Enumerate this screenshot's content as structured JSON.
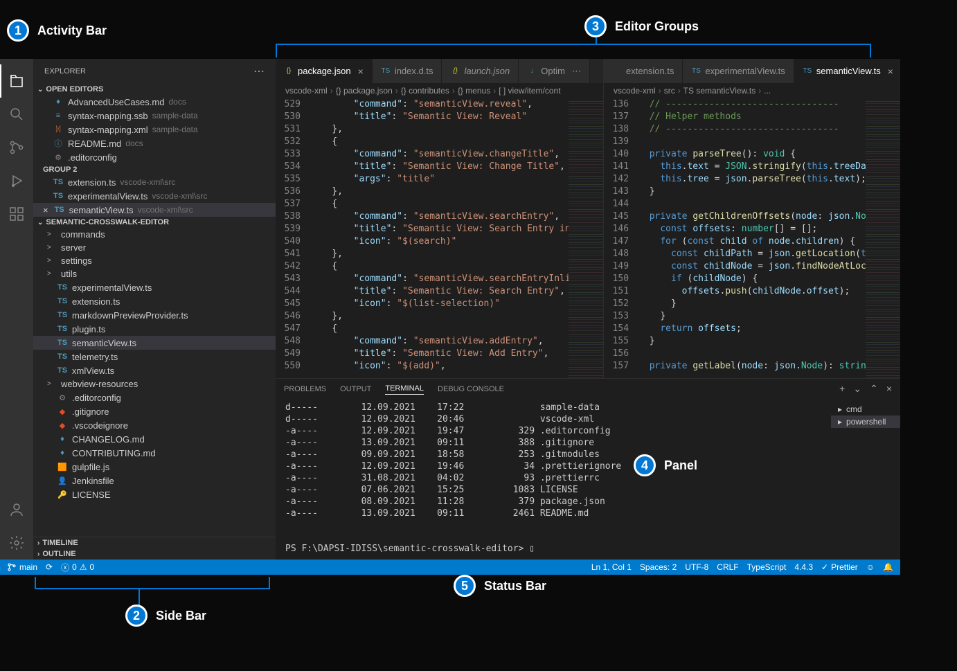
{
  "annotations": {
    "a1": "Activity Bar",
    "a2": "Side Bar",
    "a3": "Editor Groups",
    "a4": "Panel",
    "a5": "Status Bar"
  },
  "sidebar": {
    "title": "EXPLORER",
    "open_editors": "OPEN EDITORS",
    "group2": "GROUP 2",
    "project": "SEMANTIC-CROSSWALK-EDITOR",
    "timeline": "TIMELINE",
    "outline": "OUTLINE",
    "editors": [
      {
        "name": "AdvancedUseCases.md",
        "detail": "docs",
        "icon": "md"
      },
      {
        "name": "syntax-mapping.ssb",
        "detail": "sample-data",
        "icon": "ssb"
      },
      {
        "name": "syntax-mapping.xml",
        "detail": "sample-data",
        "icon": "xml"
      },
      {
        "name": "README.md",
        "detail": "docs",
        "icon": "md-info"
      },
      {
        "name": ".editorconfig",
        "detail": "",
        "icon": "gear"
      }
    ],
    "group2_items": [
      {
        "name": "extension.ts",
        "detail": "vscode-xml\\src",
        "icon": "ts"
      },
      {
        "name": "experimentalView.ts",
        "detail": "vscode-xml\\src",
        "icon": "ts"
      },
      {
        "name": "semanticView.ts",
        "detail": "vscode-xml\\src",
        "icon": "ts",
        "active": true,
        "close": true
      }
    ],
    "tree": [
      {
        "name": "commands",
        "type": "folder",
        "chev": ">"
      },
      {
        "name": "server",
        "type": "folder",
        "chev": ">"
      },
      {
        "name": "settings",
        "type": "folder",
        "chev": ">"
      },
      {
        "name": "utils",
        "type": "folder",
        "chev": ">"
      },
      {
        "name": "experimentalView.ts",
        "type": "ts"
      },
      {
        "name": "extension.ts",
        "type": "ts"
      },
      {
        "name": "markdownPreviewProvider.ts",
        "type": "ts"
      },
      {
        "name": "plugin.ts",
        "type": "ts"
      },
      {
        "name": "semanticView.ts",
        "type": "ts",
        "active": true
      },
      {
        "name": "telemetry.ts",
        "type": "ts"
      },
      {
        "name": "xmlView.ts",
        "type": "ts"
      },
      {
        "name": "webview-resources",
        "type": "folder",
        "chev": ">"
      },
      {
        "name": ".editorconfig",
        "type": "gear"
      },
      {
        "name": ".gitignore",
        "type": "git"
      },
      {
        "name": ".vscodeignore",
        "type": "git"
      },
      {
        "name": "CHANGELOG.md",
        "type": "md"
      },
      {
        "name": "CONTRIBUTING.md",
        "type": "md-blue"
      },
      {
        "name": "gulpfile.js",
        "type": "js"
      },
      {
        "name": "Jenkinsfile",
        "type": "jenkins"
      },
      {
        "name": "LICENSE",
        "type": "license"
      }
    ]
  },
  "tabs1": [
    {
      "label": "package.json",
      "icon": "{}",
      "active": true,
      "close": true,
      "color": "#cbcb41"
    },
    {
      "label": "index.d.ts",
      "icon": "TS",
      "color": "#519aba"
    },
    {
      "label": "launch.json",
      "icon": "{}",
      "italic": true,
      "color": "#cbcb41"
    },
    {
      "label": "Optim",
      "icon": "↓",
      "color": "#519aba",
      "overflow": true
    }
  ],
  "tabs2": [
    {
      "label": "extension.ts",
      "icon": "",
      "partial": true
    },
    {
      "label": "experimentalView.ts",
      "icon": "TS",
      "color": "#519aba"
    },
    {
      "label": "semanticView.ts",
      "icon": "TS",
      "active": true,
      "close": true,
      "color": "#519aba"
    }
  ],
  "breadcrumb1": [
    "vscode-xml",
    "{} package.json",
    "{} contributes",
    "{} menus",
    "[ ] view/item/cont"
  ],
  "breadcrumb2": [
    "vscode-xml",
    "src",
    "TS semanticView.ts",
    "..."
  ],
  "code1_lines": [
    529,
    530,
    531,
    532,
    533,
    534,
    535,
    536,
    537,
    538,
    539,
    540,
    541,
    542,
    543,
    544,
    545,
    546,
    547,
    548,
    549,
    550
  ],
  "code1_content": [
    {
      "indent": 4,
      "parts": [
        [
          "key",
          "\"command\""
        ],
        [
          "punc",
          ": "
        ],
        [
          "str",
          "\"semanticView.reveal\""
        ],
        [
          "punc",
          ","
        ]
      ]
    },
    {
      "indent": 4,
      "parts": [
        [
          "key",
          "\"title\""
        ],
        [
          "punc",
          ": "
        ],
        [
          "str",
          "\"Semantic View: Reveal\""
        ]
      ]
    },
    {
      "indent": 2,
      "parts": [
        [
          "punc",
          "},"
        ]
      ]
    },
    {
      "indent": 2,
      "parts": [
        [
          "punc",
          "{"
        ]
      ]
    },
    {
      "indent": 4,
      "parts": [
        [
          "key",
          "\"command\""
        ],
        [
          "punc",
          ": "
        ],
        [
          "str",
          "\"semanticView.changeTitle\""
        ],
        [
          "punc",
          ","
        ]
      ]
    },
    {
      "indent": 4,
      "parts": [
        [
          "key",
          "\"title\""
        ],
        [
          "punc",
          ": "
        ],
        [
          "str",
          "\"Semantic View: Change Title\""
        ],
        [
          "punc",
          ","
        ]
      ]
    },
    {
      "indent": 4,
      "parts": [
        [
          "key",
          "\"args\""
        ],
        [
          "punc",
          ": "
        ],
        [
          "str",
          "\"title\""
        ]
      ]
    },
    {
      "indent": 2,
      "parts": [
        [
          "punc",
          "},"
        ]
      ]
    },
    {
      "indent": 2,
      "parts": [
        [
          "punc",
          "{"
        ]
      ]
    },
    {
      "indent": 4,
      "parts": [
        [
          "key",
          "\"command\""
        ],
        [
          "punc",
          ": "
        ],
        [
          "str",
          "\"semanticView.searchEntry\""
        ],
        [
          "punc",
          ","
        ]
      ]
    },
    {
      "indent": 4,
      "parts": [
        [
          "key",
          "\"title\""
        ],
        [
          "punc",
          ": "
        ],
        [
          "str",
          "\"Semantic View: Search Entry in a"
        ]
      ]
    },
    {
      "indent": 4,
      "parts": [
        [
          "key",
          "\"icon\""
        ],
        [
          "punc",
          ": "
        ],
        [
          "str",
          "\"$(search)\""
        ]
      ]
    },
    {
      "indent": 2,
      "parts": [
        [
          "punc",
          "},"
        ]
      ]
    },
    {
      "indent": 2,
      "parts": [
        [
          "punc",
          "{"
        ]
      ]
    },
    {
      "indent": 4,
      "parts": [
        [
          "key",
          "\"command\""
        ],
        [
          "punc",
          ": "
        ],
        [
          "str",
          "\"semanticView.searchEntryInline\""
        ]
      ]
    },
    {
      "indent": 4,
      "parts": [
        [
          "key",
          "\"title\""
        ],
        [
          "punc",
          ": "
        ],
        [
          "str",
          "\"Semantic View: Search Entry\""
        ],
        [
          "punc",
          ","
        ]
      ]
    },
    {
      "indent": 4,
      "parts": [
        [
          "key",
          "\"icon\""
        ],
        [
          "punc",
          ": "
        ],
        [
          "str",
          "\"$(list-selection)\""
        ]
      ]
    },
    {
      "indent": 2,
      "parts": [
        [
          "punc",
          "},"
        ]
      ]
    },
    {
      "indent": 2,
      "parts": [
        [
          "punc",
          "{"
        ]
      ]
    },
    {
      "indent": 4,
      "parts": [
        [
          "key",
          "\"command\""
        ],
        [
          "punc",
          ": "
        ],
        [
          "str",
          "\"semanticView.addEntry\""
        ],
        [
          "punc",
          ","
        ]
      ]
    },
    {
      "indent": 4,
      "parts": [
        [
          "key",
          "\"title\""
        ],
        [
          "punc",
          ": "
        ],
        [
          "str",
          "\"Semantic View: Add Entry\""
        ],
        [
          "punc",
          ","
        ]
      ]
    },
    {
      "indent": 4,
      "parts": [
        [
          "key",
          "\"icon\""
        ],
        [
          "punc",
          ": "
        ],
        [
          "str",
          "\"$(add)\""
        ],
        [
          "punc",
          ","
        ]
      ]
    }
  ],
  "code2_lines": [
    136,
    137,
    138,
    139,
    140,
    141,
    142,
    143,
    144,
    145,
    146,
    147,
    148,
    149,
    150,
    151,
    152,
    153,
    154,
    155,
    156,
    157
  ],
  "code2_content": [
    {
      "indent": 1,
      "parts": [
        [
          "com",
          "// --------------------------------"
        ]
      ]
    },
    {
      "indent": 1,
      "parts": [
        [
          "com",
          "// Helper methods"
        ]
      ]
    },
    {
      "indent": 1,
      "parts": [
        [
          "com",
          "// --------------------------------"
        ]
      ]
    },
    {
      "indent": 0,
      "parts": []
    },
    {
      "indent": 1,
      "parts": [
        [
          "kw",
          "private"
        ],
        [
          "punc",
          " "
        ],
        [
          "fn",
          "parseTree"
        ],
        [
          "punc",
          "(): "
        ],
        [
          "type",
          "void"
        ],
        [
          "punc",
          " {"
        ]
      ]
    },
    {
      "indent": 2,
      "parts": [
        [
          "const",
          "this"
        ],
        [
          "punc",
          "."
        ],
        [
          "var",
          "text"
        ],
        [
          "punc",
          " = "
        ],
        [
          "type",
          "JSON"
        ],
        [
          "punc",
          "."
        ],
        [
          "fn",
          "stringify"
        ],
        [
          "punc",
          "("
        ],
        [
          "const",
          "this"
        ],
        [
          "punc",
          "."
        ],
        [
          "var",
          "treeData"
        ],
        [
          "punc",
          ")"
        ]
      ]
    },
    {
      "indent": 2,
      "parts": [
        [
          "const",
          "this"
        ],
        [
          "punc",
          "."
        ],
        [
          "var",
          "tree"
        ],
        [
          "punc",
          " = "
        ],
        [
          "var",
          "json"
        ],
        [
          "punc",
          "."
        ],
        [
          "fn",
          "parseTree"
        ],
        [
          "punc",
          "("
        ],
        [
          "const",
          "this"
        ],
        [
          "punc",
          "."
        ],
        [
          "var",
          "text"
        ],
        [
          "punc",
          ");"
        ]
      ]
    },
    {
      "indent": 1,
      "parts": [
        [
          "punc",
          "}"
        ]
      ]
    },
    {
      "indent": 0,
      "parts": []
    },
    {
      "indent": 1,
      "parts": [
        [
          "kw",
          "private"
        ],
        [
          "punc",
          " "
        ],
        [
          "fn",
          "getChildrenOffsets"
        ],
        [
          "punc",
          "("
        ],
        [
          "var",
          "node"
        ],
        [
          "punc",
          ": "
        ],
        [
          "var",
          "json"
        ],
        [
          "punc",
          "."
        ],
        [
          "type",
          "Node"
        ],
        [
          "punc",
          ")"
        ]
      ]
    },
    {
      "indent": 2,
      "parts": [
        [
          "kw",
          "const"
        ],
        [
          "punc",
          " "
        ],
        [
          "var",
          "offsets"
        ],
        [
          "punc",
          ": "
        ],
        [
          "type",
          "number"
        ],
        [
          "punc",
          "[] = [];"
        ]
      ]
    },
    {
      "indent": 2,
      "parts": [
        [
          "kw",
          "for"
        ],
        [
          "punc",
          " ("
        ],
        [
          "kw",
          "const"
        ],
        [
          "punc",
          " "
        ],
        [
          "var",
          "child"
        ],
        [
          "punc",
          " "
        ],
        [
          "kw",
          "of"
        ],
        [
          "punc",
          " "
        ],
        [
          "var",
          "node"
        ],
        [
          "punc",
          "."
        ],
        [
          "var",
          "children"
        ],
        [
          "punc",
          ") {"
        ]
      ]
    },
    {
      "indent": 3,
      "parts": [
        [
          "kw",
          "const"
        ],
        [
          "punc",
          " "
        ],
        [
          "var",
          "childPath"
        ],
        [
          "punc",
          " = "
        ],
        [
          "var",
          "json"
        ],
        [
          "punc",
          "."
        ],
        [
          "fn",
          "getLocation"
        ],
        [
          "punc",
          "("
        ],
        [
          "const",
          "this"
        ]
      ]
    },
    {
      "indent": 3,
      "parts": [
        [
          "kw",
          "const"
        ],
        [
          "punc",
          " "
        ],
        [
          "var",
          "childNode"
        ],
        [
          "punc",
          " = "
        ],
        [
          "var",
          "json"
        ],
        [
          "punc",
          "."
        ],
        [
          "fn",
          "findNodeAtLocati"
        ]
      ]
    },
    {
      "indent": 3,
      "parts": [
        [
          "kw",
          "if"
        ],
        [
          "punc",
          " ("
        ],
        [
          "var",
          "childNode"
        ],
        [
          "punc",
          ") {"
        ]
      ]
    },
    {
      "indent": 4,
      "parts": [
        [
          "var",
          "offsets"
        ],
        [
          "punc",
          "."
        ],
        [
          "fn",
          "push"
        ],
        [
          "punc",
          "("
        ],
        [
          "var",
          "childNode"
        ],
        [
          "punc",
          "."
        ],
        [
          "var",
          "offset"
        ],
        [
          "punc",
          ");"
        ]
      ]
    },
    {
      "indent": 3,
      "parts": [
        [
          "punc",
          "}"
        ]
      ]
    },
    {
      "indent": 2,
      "parts": [
        [
          "punc",
          "}"
        ]
      ]
    },
    {
      "indent": 2,
      "parts": [
        [
          "kw",
          "return"
        ],
        [
          "punc",
          " "
        ],
        [
          "var",
          "offsets"
        ],
        [
          "punc",
          ";"
        ]
      ]
    },
    {
      "indent": 1,
      "parts": [
        [
          "punc",
          "}"
        ]
      ]
    },
    {
      "indent": 0,
      "parts": []
    },
    {
      "indent": 1,
      "parts": [
        [
          "kw",
          "private"
        ],
        [
          "punc",
          " "
        ],
        [
          "fn",
          "getLabel"
        ],
        [
          "punc",
          "("
        ],
        [
          "var",
          "node"
        ],
        [
          "punc",
          ": "
        ],
        [
          "var",
          "json"
        ],
        [
          "punc",
          "."
        ],
        [
          "type",
          "Node"
        ],
        [
          "punc",
          "): "
        ],
        [
          "type",
          "string"
        ],
        [
          "punc",
          " {"
        ]
      ]
    }
  ],
  "panel": {
    "tabs": [
      "PROBLEMS",
      "OUTPUT",
      "TERMINAL",
      "DEBUG CONSOLE"
    ],
    "active": "TERMINAL",
    "terminals": [
      "cmd",
      "powershell"
    ],
    "active_terminal": "powershell",
    "rows": [
      [
        "d-----",
        "12.09.2021",
        "17:22",
        "",
        "sample-data"
      ],
      [
        "d-----",
        "12.09.2021",
        "20:46",
        "",
        "vscode-xml"
      ],
      [
        "-a----",
        "12.09.2021",
        "19:47",
        "329",
        ".editorconfig"
      ],
      [
        "-a----",
        "13.09.2021",
        "09:11",
        "388",
        ".gitignore"
      ],
      [
        "-a----",
        "09.09.2021",
        "18:58",
        "253",
        ".gitmodules"
      ],
      [
        "-a----",
        "12.09.2021",
        "19:46",
        "34",
        ".prettierignore"
      ],
      [
        "-a----",
        "31.08.2021",
        "04:02",
        "93",
        ".prettierrc"
      ],
      [
        "-a----",
        "07.06.2021",
        "15:25",
        "1083",
        "LICENSE"
      ],
      [
        "-a----",
        "08.09.2021",
        "11:28",
        "379",
        "package.json"
      ],
      [
        "-a----",
        "13.09.2021",
        "09:11",
        "2461",
        "README.md"
      ]
    ],
    "prompt": "PS F:\\DAPSI-IDISS\\semantic-crosswalk-editor> "
  },
  "status": {
    "branch": "main",
    "errors": "0",
    "warnings": "0",
    "line": "Ln 1, Col 1",
    "spaces": "Spaces: 2",
    "encoding": "UTF-8",
    "eol": "CRLF",
    "lang": "TypeScript",
    "ver": "4.4.3",
    "prettier": "Prettier"
  }
}
